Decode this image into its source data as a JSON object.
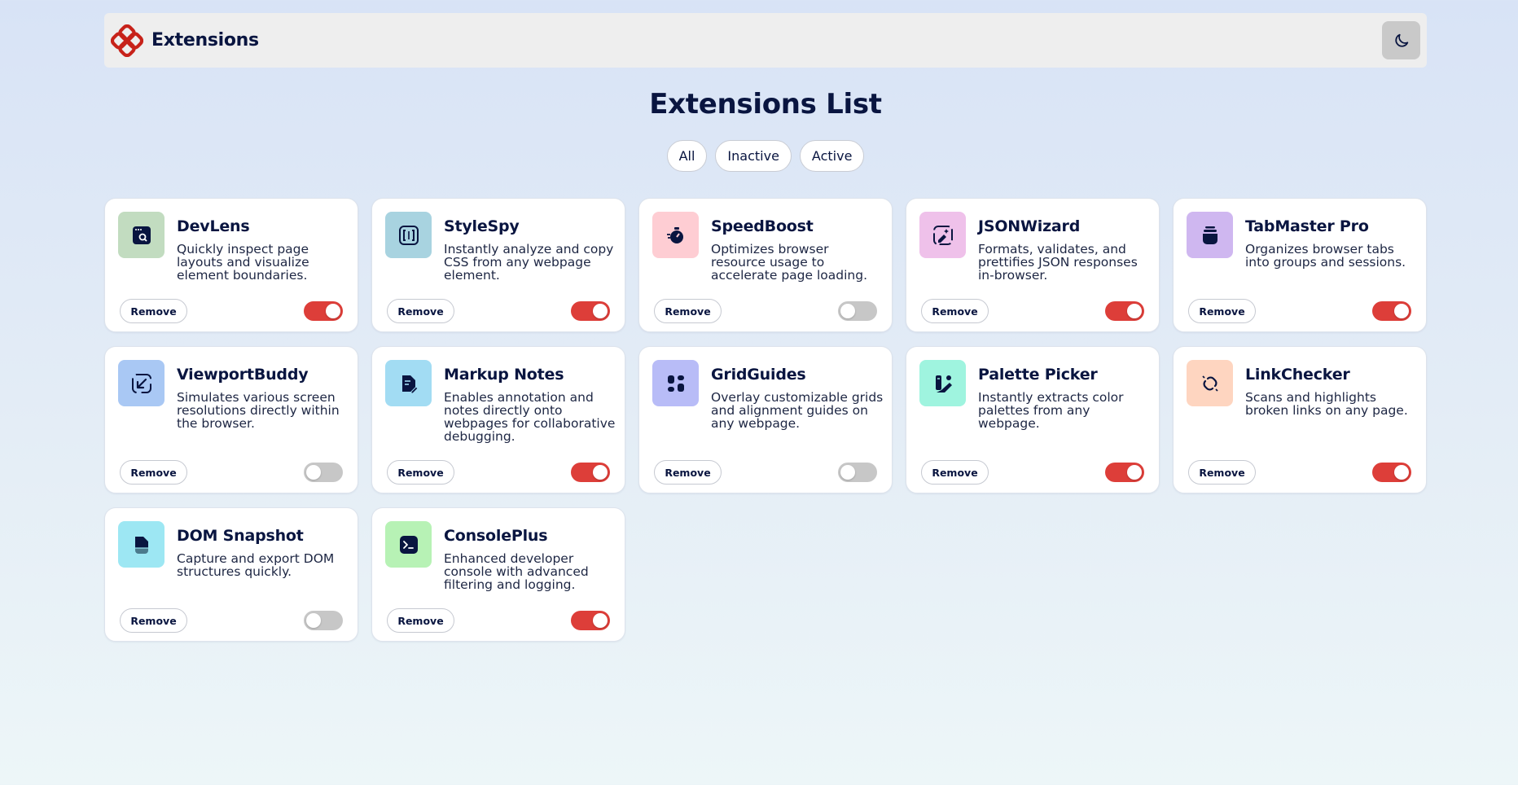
{
  "header": {
    "app_name": "Extensions",
    "logo_icon": "extensions-logo-icon",
    "theme_toggle_icon": "moon-icon",
    "brand_color": "#c7221a"
  },
  "page": {
    "title": "Extensions List"
  },
  "filters": [
    {
      "label": "All"
    },
    {
      "label": "Inactive"
    },
    {
      "label": "Active"
    }
  ],
  "colors": {
    "toggle_on": "#dd3e39",
    "toggle_off": "#c7c7c7",
    "text": "#091540"
  },
  "extensions": [
    {
      "name": "DevLens",
      "description": "Quickly inspect page layouts and visualize element boundaries.",
      "remove_label": "Remove",
      "active": true,
      "icon": "devlens-icon",
      "icon_bg": "#c2dcc0"
    },
    {
      "name": "StyleSpy",
      "description": "Instantly analyze and copy CSS from any webpage element.",
      "remove_label": "Remove",
      "active": true,
      "icon": "stylespy-icon",
      "icon_bg": "#a8d3e0"
    },
    {
      "name": "SpeedBoost",
      "description": "Optimizes browser resource usage to accelerate page loading.",
      "remove_label": "Remove",
      "active": false,
      "icon": "speedboost-icon",
      "icon_bg": "#fecdd3"
    },
    {
      "name": "JSONWizard",
      "description": "Formats, validates, and prettifies JSON responses in-browser.",
      "remove_label": "Remove",
      "active": true,
      "icon": "jsonwizard-icon",
      "icon_bg": "#efc1ea"
    },
    {
      "name": "TabMaster Pro",
      "description": "Organizes browser tabs into groups and sessions.",
      "remove_label": "Remove",
      "active": true,
      "icon": "tabmaster-icon",
      "icon_bg": "#cfb7f0"
    },
    {
      "name": "ViewportBuddy",
      "description": "Simulates various screen resolutions directly within the browser.",
      "remove_label": "Remove",
      "active": false,
      "icon": "viewportbuddy-icon",
      "icon_bg": "#a9c8f4"
    },
    {
      "name": "Markup Notes",
      "description": "Enables annotation and notes directly onto webpages for collaborative debugging.",
      "remove_label": "Remove",
      "active": true,
      "icon": "markup-notes-icon",
      "icon_bg": "#a2dcf3"
    },
    {
      "name": "GridGuides",
      "description": "Overlay customizable grids and alignment guides on any webpage.",
      "remove_label": "Remove",
      "active": false,
      "icon": "gridguides-icon",
      "icon_bg": "#b8bcf7"
    },
    {
      "name": "Palette Picker",
      "description": "Instantly extracts color palettes from any webpage.",
      "remove_label": "Remove",
      "active": true,
      "icon": "palette-picker-icon",
      "icon_bg": "#9ff4df"
    },
    {
      "name": "LinkChecker",
      "description": "Scans and highlights broken links on any page.",
      "remove_label": "Remove",
      "active": true,
      "icon": "linkchecker-icon",
      "icon_bg": "#fed5c0"
    },
    {
      "name": "DOM Snapshot",
      "description": "Capture and export DOM structures quickly.",
      "remove_label": "Remove",
      "active": false,
      "icon": "dom-snapshot-icon",
      "icon_bg": "#9de7f3"
    },
    {
      "name": "ConsolePlus",
      "description": "Enhanced developer console with advanced filtering and logging.",
      "remove_label": "Remove",
      "active": true,
      "icon": "consoleplus-icon",
      "icon_bg": "#b7f2b5"
    }
  ]
}
